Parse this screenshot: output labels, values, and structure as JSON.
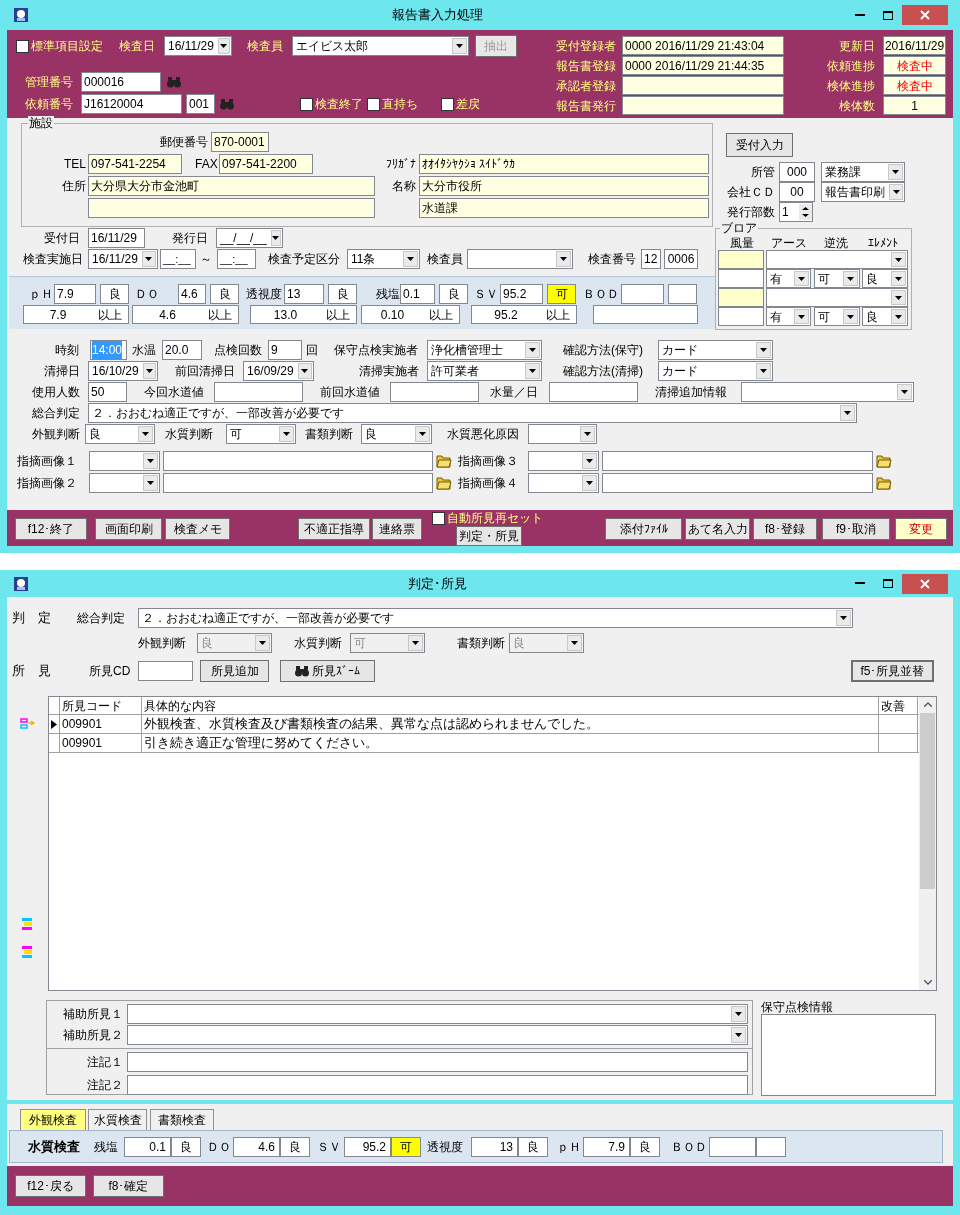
{
  "report_window": {
    "title": "報告書入力処理",
    "header": {
      "standard_items": {
        "label": "標準項目設定",
        "checked": false
      },
      "inspection_date": {
        "label": "検査日",
        "value": "16/11/29"
      },
      "inspector": {
        "label": "検査員",
        "value": "エイビス太郎"
      },
      "extract_button": {
        "label": "抽出",
        "disabled": true
      },
      "management_no": {
        "label": "管理番号",
        "value": "000016"
      },
      "request_no": {
        "label": "依頼番号",
        "value": "J16120004",
        "branch": "001"
      },
      "flags": [
        {
          "label": "検査終了",
          "checked": false
        },
        {
          "label": "直持ち",
          "checked": false
        },
        {
          "label": "差戻",
          "checked": false
        }
      ],
      "registrations": [
        {
          "label": "受付登録者",
          "value": "0000 2016/11/29 21:43:04"
        },
        {
          "label": "報告書登録",
          "value": "0000 2016/11/29 21:44:35"
        },
        {
          "label": "承認者登録"
        },
        {
          "label": "報告書発行"
        }
      ],
      "status": [
        {
          "label": "更新日",
          "value": "2016/11/29",
          "alert": false
        },
        {
          "label": "依頼進捗",
          "value": "検査中",
          "alert": true
        },
        {
          "label": "検体進捗",
          "value": "検査中",
          "alert": true
        },
        {
          "label": "検体数",
          "value": "1",
          "alert": false
        }
      ]
    },
    "facility": {
      "title": "施設",
      "postal_code": {
        "label": "郵便番号",
        "value": "870-0001"
      },
      "tel": {
        "label": "TEL",
        "value": "097-541-2254"
      },
      "fax": {
        "label": "FAX",
        "value": "097-541-2200"
      },
      "kana": {
        "label": "ﾌﾘｶﾞﾅ",
        "value": "ｵｵｲﾀｼﾔｸｼｮ ｽｲﾄﾞｳｶ"
      },
      "address": {
        "label": "住所",
        "value": "大分県大分市金池町"
      },
      "name": {
        "label": "名称",
        "value": "大分市役所",
        "department": "水道課"
      }
    },
    "side": {
      "reception_button": "受付入力",
      "office": {
        "label": "所管",
        "code": "000",
        "value": "業務課"
      },
      "company": {
        "label": "会社ＣＤ",
        "code": "00",
        "value": "報告書印刷"
      },
      "copies": {
        "label": "発行部数",
        "value": "1"
      }
    },
    "blower": {
      "title": "ブロア",
      "columns": [
        "風量",
        "アース",
        "逆洗",
        "ｴﾚﾒﾝﾄ"
      ],
      "units": [
        {
          "earth": "有",
          "backwash": "可",
          "element": "良"
        },
        {
          "earth": "有",
          "backwash": "可",
          "element": "良"
        }
      ]
    },
    "dates": {
      "receipt_date": {
        "label": "受付日",
        "value": "16/11/29"
      },
      "issue_date": {
        "label": "発行日",
        "value": "__/__/__"
      },
      "inspection_date": {
        "label": "検査実施日",
        "value": "16/11/29",
        "time_from": "__:__",
        "separator": "～",
        "time_to": "__:__"
      },
      "schedule": {
        "label": "検査予定区分",
        "value": "11条"
      },
      "inspector": {
        "label": "検査員"
      },
      "inspection_no": {
        "label": "検査番号",
        "value": "12",
        "sequence": "0006"
      }
    },
    "measurements": [
      {
        "label": "ｐＨ",
        "value": "7.9",
        "grade": "良",
        "highlight": false,
        "standard": "7.9",
        "condition": "以上"
      },
      {
        "label": "ＤＯ",
        "value": "4.6",
        "grade": "良",
        "highlight": false,
        "standard": "4.6",
        "condition": "以上"
      },
      {
        "label": "透視度",
        "value": "13",
        "grade": "良",
        "highlight": false,
        "standard": "13.0",
        "condition": "以上"
      },
      {
        "label": "残塩",
        "value": "0.1",
        "grade": "良",
        "highlight": false,
        "standard": "0.10",
        "condition": "以上"
      },
      {
        "label": "ＳＶ",
        "value": "95.2",
        "grade": "可",
        "highlight": true,
        "standard": "95.2",
        "condition": "以上"
      },
      {
        "label": "ＢＯＤ"
      }
    ],
    "details": {
      "time": {
        "label": "時刻",
        "value": "14:00",
        "selected": true
      },
      "water_temp": {
        "label": "水温",
        "value": "20.0"
      },
      "check_count": {
        "label": "点検回数",
        "value": "9",
        "unit": "回"
      },
      "maintainer": {
        "label": "保守点検実施者",
        "value": "浄化槽管理士"
      },
      "confirm_maintenance": {
        "label": "確認方法(保守)",
        "value": "カード"
      },
      "cleaning_date": {
        "label": "清掃日",
        "value": "16/10/29"
      },
      "prev_cleaning_date": {
        "label": "前回清掃日",
        "value": "16/09/29"
      },
      "cleaner": {
        "label": "清掃実施者",
        "value": "許可業者"
      },
      "confirm_cleaning": {
        "label": "確認方法(清掃)",
        "value": "カード"
      },
      "users": {
        "label": "使用人数",
        "value": "50"
      },
      "water_now": {
        "label": "今回水道値"
      },
      "water_prev": {
        "label": "前回水道値"
      },
      "water_per_day": {
        "label": "水量／日"
      },
      "cleaning_info": {
        "label": "清掃追加情報"
      },
      "overall": {
        "label": "総合判定",
        "value": "２．おおむね適正ですが、一部改善が必要です"
      },
      "judgments": [
        {
          "label": "外観判断",
          "value": "良"
        },
        {
          "label": "水質判断",
          "value": "可"
        },
        {
          "label": "書類判断",
          "value": "良"
        },
        {
          "label": "水質悪化原因"
        }
      ],
      "images": [
        {
          "label": "指摘画像１"
        },
        {
          "label": "指摘画像３"
        },
        {
          "label": "指摘画像２"
        },
        {
          "label": "指摘画像４"
        }
      ]
    },
    "footer": {
      "left_buttons": [
        "f12･終了",
        "画面印刷",
        "検査メモ"
      ],
      "middle_buttons": [
        "不適正指導",
        "連絡票"
      ],
      "auto_reset": {
        "label": "自動所見再セット",
        "checked": false
      },
      "judgment_button": "判定・所見",
      "right_buttons": [
        {
          "label": "添付ﾌｧｲﾙ",
          "highlight": false
        },
        {
          "label": "あて名入力",
          "highlight": false
        },
        {
          "label": "f8･登録",
          "highlight": false
        },
        {
          "label": "f9･取消",
          "highlight": false
        },
        {
          "label": "変更",
          "highlight": true
        }
      ]
    }
  },
  "judgment_window": {
    "title": "判定･所見",
    "judgment_label": "判　定",
    "overall": {
      "label": "総合判定",
      "value": "２．おおむね適正ですが、一部改善が必要です"
    },
    "judgments": [
      {
        "label": "外観判断",
        "value": "良",
        "disabled": true
      },
      {
        "label": "水質判断",
        "value": "可",
        "disabled": true
      },
      {
        "label": "書類判断",
        "value": "良",
        "disabled": true
      }
    ],
    "findings_label": "所　見",
    "finding_code": {
      "label": "所見CD"
    },
    "add_button": "所見追加",
    "zoom_button": "所見ｽﾞｰﾑ",
    "sort_button": "f5･所見並替",
    "grid": {
      "columns": [
        "所見コード",
        "具体的な内容",
        "改善"
      ],
      "rows": [
        {
          "code": "009901",
          "content": "外観検査、水質検査及び書類検査の結果、異常な点は認められませんでした。",
          "selected": true
        },
        {
          "code": "009901",
          "content": "引き続き適正な管理に努めてください。",
          "selected": false
        }
      ]
    },
    "supplementary": [
      {
        "label": "補助所見１"
      },
      {
        "label": "補助所見２"
      }
    ],
    "notes": [
      {
        "label": "注記１"
      },
      {
        "label": "注記２"
      }
    ],
    "maintenance_info": {
      "label": "保守点検情報"
    },
    "tabs": [
      {
        "label": "外観検査",
        "selected": true
      },
      {
        "label": "水質検査",
        "selected": false
      },
      {
        "label": "書類検査",
        "selected": false
      }
    ],
    "summary": {
      "title": "水質検査",
      "items": [
        {
          "label": "残塩",
          "value": "0.1",
          "grade": "良",
          "highlight": false
        },
        {
          "label": "ＤＯ",
          "value": "4.6",
          "grade": "良",
          "highlight": false
        },
        {
          "label": "ＳＶ",
          "value": "95.2",
          "grade": "可",
          "highlight": true
        },
        {
          "label": "透視度",
          "value": "13",
          "grade": "良",
          "highlight": false
        },
        {
          "label": "ｐＨ",
          "value": "7.9",
          "grade": "良",
          "highlight": false
        },
        {
          "label": "ＢＯＤ"
        }
      ]
    },
    "footer_buttons": [
      "f12･戻る",
      "f8･確定"
    ]
  }
}
